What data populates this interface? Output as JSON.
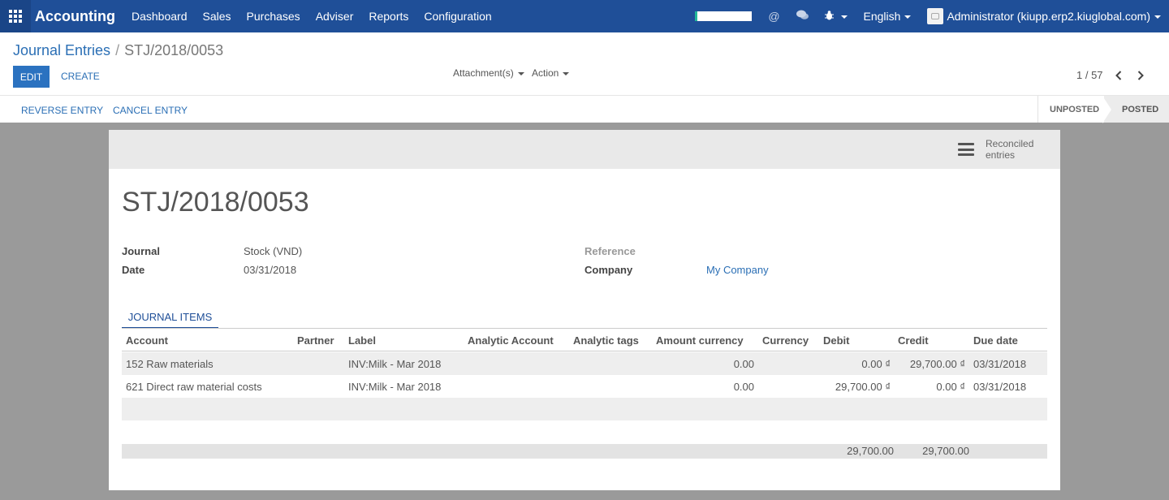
{
  "navbar": {
    "app_name": "Accounting",
    "menus": [
      "Dashboard",
      "Sales",
      "Purchases",
      "Adviser",
      "Reports",
      "Configuration"
    ],
    "icons": [
      "at-icon",
      "chat-icon",
      "bug-icon"
    ],
    "language": "English",
    "user": "Administrator (kiupp.erp2.kiuglobal.com)",
    "accent_color": "#1f4f98"
  },
  "control_panel": {
    "breadcrumb_parent": "Journal Entries",
    "breadcrumb_current": "STJ/2018/0053",
    "edit_label": "EDIT",
    "create_label": "CREATE",
    "attachments_label": "Attachment(s)",
    "action_label": "Action",
    "pager": "1 / 57"
  },
  "statusbar": {
    "reverse_label": "REVERSE ENTRY",
    "cancel_label": "CANCEL ENTRY",
    "steps": [
      "UNPOSTED",
      "POSTED"
    ],
    "active_step": "POSTED"
  },
  "sheet": {
    "stat_button": {
      "line1": "Reconciled",
      "line2": "entries"
    },
    "title": "STJ/2018/0053",
    "journal_label": "Journal",
    "journal_value": "Stock (VND)",
    "date_label": "Date",
    "date_value": "03/31/2018",
    "reference_label": "Reference",
    "company_label": "Company",
    "company_value": "My Company",
    "tab_label": "JOURNAL ITEMS"
  },
  "journal_items": {
    "columns": [
      "Account",
      "Partner",
      "Label",
      "Analytic Account",
      "Analytic tags",
      "Amount currency",
      "Currency",
      "Debit",
      "Credit",
      "Due date"
    ],
    "rows": [
      {
        "account": "152 Raw materials",
        "partner": "",
        "label": "INV:Milk - Mar 2018",
        "analytic_account": "",
        "analytic_tags": "",
        "amount_currency": "0.00",
        "currency": "",
        "debit": "0.00 ₫",
        "credit": "29,700.00 ₫",
        "due_date": "03/31/2018"
      },
      {
        "account": "621 Direct raw material costs",
        "partner": "",
        "label": "INV:Milk - Mar 2018",
        "analytic_account": "",
        "analytic_tags": "",
        "amount_currency": "0.00",
        "currency": "",
        "debit": "29,700.00 ₫",
        "credit": "0.00 ₫",
        "due_date": "03/31/2018"
      }
    ],
    "total_debit": "29,700.00",
    "total_credit": "29,700.00"
  }
}
